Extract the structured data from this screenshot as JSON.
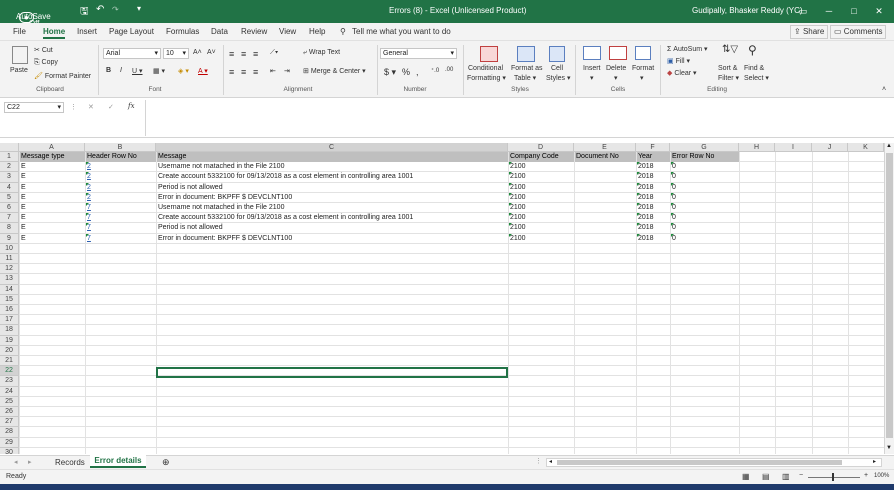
{
  "titlebar": {
    "autosave_label": "AutoSave",
    "autosave_state": "Off",
    "title": "Errors (8) - Excel (Unlicensed Product)",
    "user": "Gudipally, Bhasker Reddy (YC)"
  },
  "menu": {
    "tabs": [
      "File",
      "Home",
      "Insert",
      "Page Layout",
      "Formulas",
      "Data",
      "Review",
      "View",
      "Help"
    ],
    "active": "Home",
    "tell_me": "Tell me what you want to do",
    "share": "Share",
    "comments": "Comments"
  },
  "ribbon": {
    "clipboard": {
      "paste": "Paste",
      "cut": "Cut",
      "copy": "Copy",
      "format_painter": "Format Painter",
      "label": "Clipboard"
    },
    "font": {
      "name": "Arial",
      "size": "10",
      "label": "Font"
    },
    "alignment": {
      "wrap": "Wrap Text",
      "merge": "Merge & Center",
      "label": "Alignment"
    },
    "number": {
      "format": "General",
      "label": "Number"
    },
    "styles": {
      "conditional": "Conditional",
      "formatting": "Formatting",
      "format_as": "Format as",
      "table": "Table",
      "cell": "Cell",
      "cell_styles": "Styles",
      "label": "Styles"
    },
    "cells": {
      "insert": "Insert",
      "delete": "Delete",
      "format": "Format",
      "label": "Cells"
    },
    "editing": {
      "autosum": "AutoSum",
      "fill": "Fill",
      "clear": "Clear",
      "sort": "Sort &",
      "filter": "Filter",
      "find": "Find &",
      "select": "Select",
      "label": "Editing"
    }
  },
  "formula_bar": {
    "name_box": "C22",
    "formula": ""
  },
  "grid": {
    "columns": [
      "A",
      "B",
      "C",
      "D",
      "E",
      "F",
      "G",
      "H",
      "I",
      "J",
      "K"
    ],
    "headers": [
      "Message type",
      "Header Row No",
      "Message",
      "Company Code",
      "Document No",
      "Year",
      "Error Row No"
    ],
    "rows": [
      [
        "E",
        "2",
        "Username not matached in the File 2100",
        "2100",
        "",
        "2018",
        "0"
      ],
      [
        "E",
        "2",
        "Create account 5332100 for 09/13/2018 as a cost element in controlling area 1001",
        "2100",
        "",
        "2018",
        "0"
      ],
      [
        "E",
        "2",
        "Period  is not allowed",
        "2100",
        "",
        "2018",
        "0"
      ],
      [
        "E",
        "2",
        "Error in document: BKPFF $ DEVCLNT100",
        "2100",
        "",
        "2018",
        "0"
      ],
      [
        "E",
        "7",
        "Username not matached in the File 2100",
        "2100",
        "",
        "2018",
        "0"
      ],
      [
        "E",
        "7",
        "Create account 5332100 for 09/13/2018 as a cost element in controlling area 1001",
        "2100",
        "",
        "2018",
        "0"
      ],
      [
        "E",
        "7",
        "Period  is not allowed",
        "2100",
        "",
        "2018",
        "0"
      ],
      [
        "E",
        "7",
        "Error in document: BKPFF $ DEVCLNT100",
        "2100",
        "",
        "2018",
        "0"
      ]
    ],
    "row_numbers": [
      "1",
      "2",
      "3",
      "4",
      "5",
      "6",
      "7",
      "8",
      "9",
      "10",
      "11",
      "12",
      "13",
      "14",
      "15",
      "16",
      "17",
      "18",
      "19",
      "20",
      "21",
      "22",
      "23",
      "24",
      "25",
      "26",
      "27",
      "28",
      "29",
      "30"
    ]
  },
  "sheets": {
    "tabs": [
      "Records",
      "Error details"
    ],
    "active": "Error details"
  },
  "status": {
    "state": "Ready",
    "zoom": "100%"
  }
}
